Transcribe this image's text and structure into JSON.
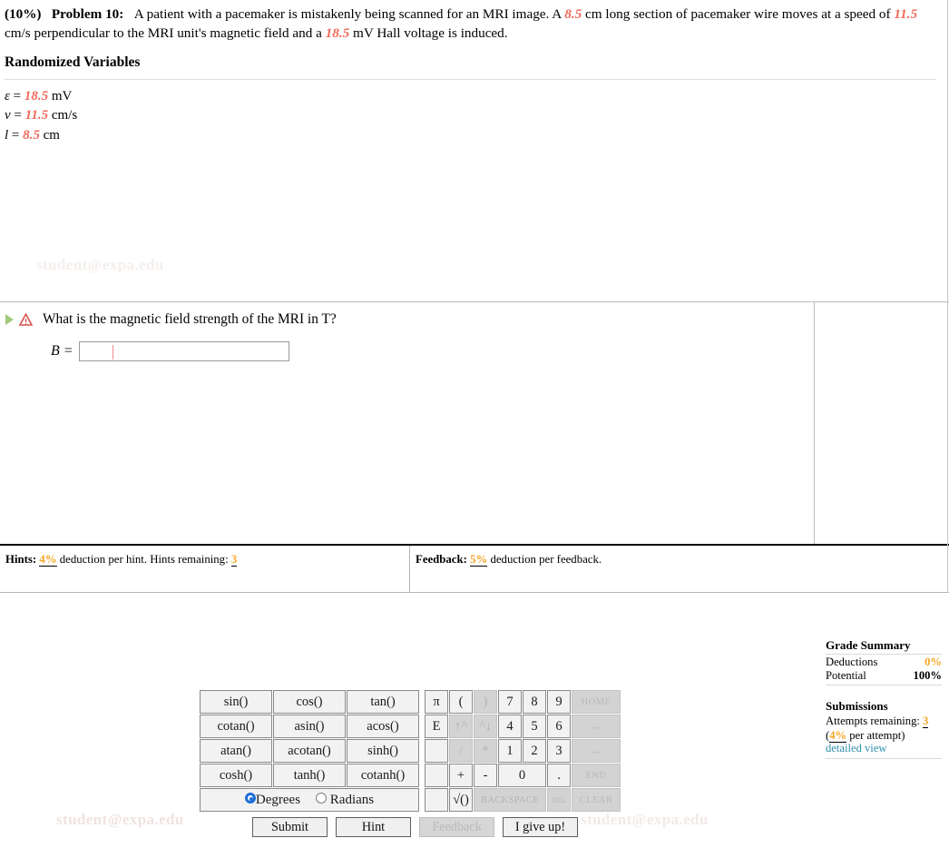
{
  "problem": {
    "percent": "(10%)",
    "label": "Problem 10:",
    "text_part1": "A patient with a pacemaker is mistakenly being scanned for an MRI image. A ",
    "value_length": "8.5",
    "text_part2": " cm long section of pacemaker wire moves at a speed of ",
    "value_speed": "11.5",
    "text_part3": " cm/s perpendicular to the MRI unit's magnetic field and a ",
    "value_voltage": "18.5",
    "text_part4": " mV Hall voltage is induced."
  },
  "randomized": {
    "heading": "Randomized Variables",
    "rows": [
      {
        "symbol": "ε",
        "eq": " = ",
        "value": "18.5",
        "unit": " mV"
      },
      {
        "symbol": "v",
        "eq": " = ",
        "value": "11.5",
        "unit": " cm/s"
      },
      {
        "symbol": "l",
        "eq": " = ",
        "value": "8.5",
        "unit": " cm"
      }
    ]
  },
  "question": {
    "text": "What is the magnetic field strength of the MRI in T?",
    "answer_variable": "B =",
    "answer_value": "",
    "answer_placeholder": ""
  },
  "calculator": {
    "functions": [
      [
        "sin()",
        "cos()",
        "tan()"
      ],
      [
        "cotan()",
        "asin()",
        "acos()"
      ],
      [
        "atan()",
        "acotan()",
        "sinh()"
      ],
      [
        "cosh()",
        "tanh()",
        "cotanh()"
      ]
    ],
    "mode_degrees": "Degrees",
    "mode_radians": "Radians",
    "mode_selected": "Degrees",
    "keypad": {
      "row1": [
        "π",
        "(",
        ")",
        "7",
        "8",
        "9",
        "HOME"
      ],
      "row2": [
        "E",
        "↑^",
        "^↓",
        "4",
        "5",
        "6",
        "←"
      ],
      "row3": [
        "",
        "/",
        "*",
        "1",
        "2",
        "3",
        "→"
      ],
      "row4": [
        "",
        "+",
        "-",
        "0",
        ".",
        "END"
      ],
      "row5": [
        "",
        "√()",
        "BACKSPACE",
        "DEL",
        "CLEAR"
      ]
    }
  },
  "actions": {
    "submit": "Submit",
    "hint": "Hint",
    "feedback": "Feedback",
    "give_up": "I give up!"
  },
  "grade_summary": {
    "title": "Grade Summary",
    "deductions_label": "Deductions",
    "deductions_value": "0%",
    "potential_label": "Potential",
    "potential_value": "100%",
    "submissions_title": "Submissions",
    "attempts_label": "Attempts remaining:",
    "attempts_value": "3",
    "per_attempt_value": "4%",
    "per_attempt_suffix": " per attempt)",
    "per_attempt_prefix": "(",
    "detailed_view": "detailed view"
  },
  "footer": {
    "hints_label": "Hints:",
    "hints_value": "4%",
    "hints_text": " deduction per hint. Hints remaining: ",
    "hints_remaining": "3",
    "feedback_label": "Feedback:",
    "feedback_value": "5%",
    "feedback_text": " deduction per feedback."
  },
  "watermark": {
    "text1": "student@expa.edu",
    "text2": "student@expa.edu",
    "text3": "student@expa.edu"
  },
  "colors": {
    "random_value": "#f06a5a",
    "accent_orange": "#f5a623",
    "link": "#2e8fab",
    "radio_selected": "#1f6fd4"
  }
}
